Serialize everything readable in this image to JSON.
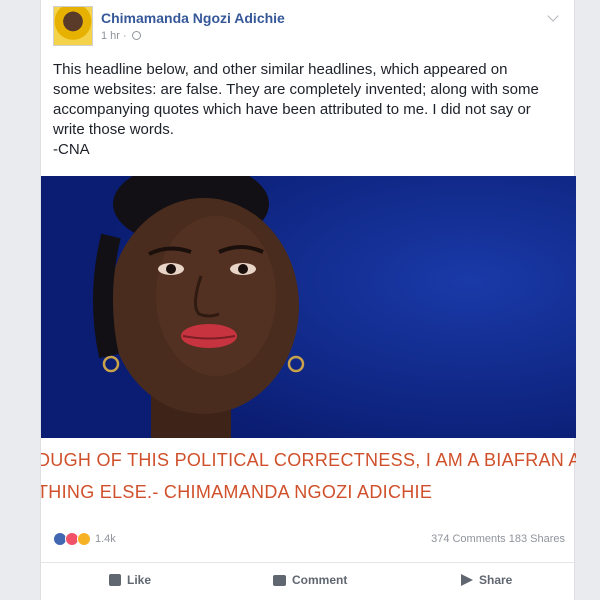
{
  "post": {
    "author": "Chimamanda Ngozi Adichie",
    "timestamp": "1 hr",
    "privacy_icon": "globe-icon",
    "text_lines": [
      "This headline below, and other similar headlines, which appeared on",
      "some websites: are false. They are completely invented; along with some",
      "accompanying quotes which have been attributed to me. I did not say or",
      "write those words.",
      "-CNA"
    ]
  },
  "shared_link": {
    "headline_lines": [
      "DUGH OF THIS POLITICAL CORRECTNESS, I AM A BIAFRAN AND",
      "THING ELSE.- CHIMAMANDA NGOZI ADICHIE"
    ]
  },
  "stats": {
    "reaction_count": "1.4k",
    "comments_shares": "374 Comments 183 Shares"
  },
  "actions": {
    "like": "Like",
    "comment": "Comment",
    "share": "Share"
  },
  "colors": {
    "author": "#365899",
    "headline": "#d0502b",
    "image_bg": "#0d2a8c"
  }
}
